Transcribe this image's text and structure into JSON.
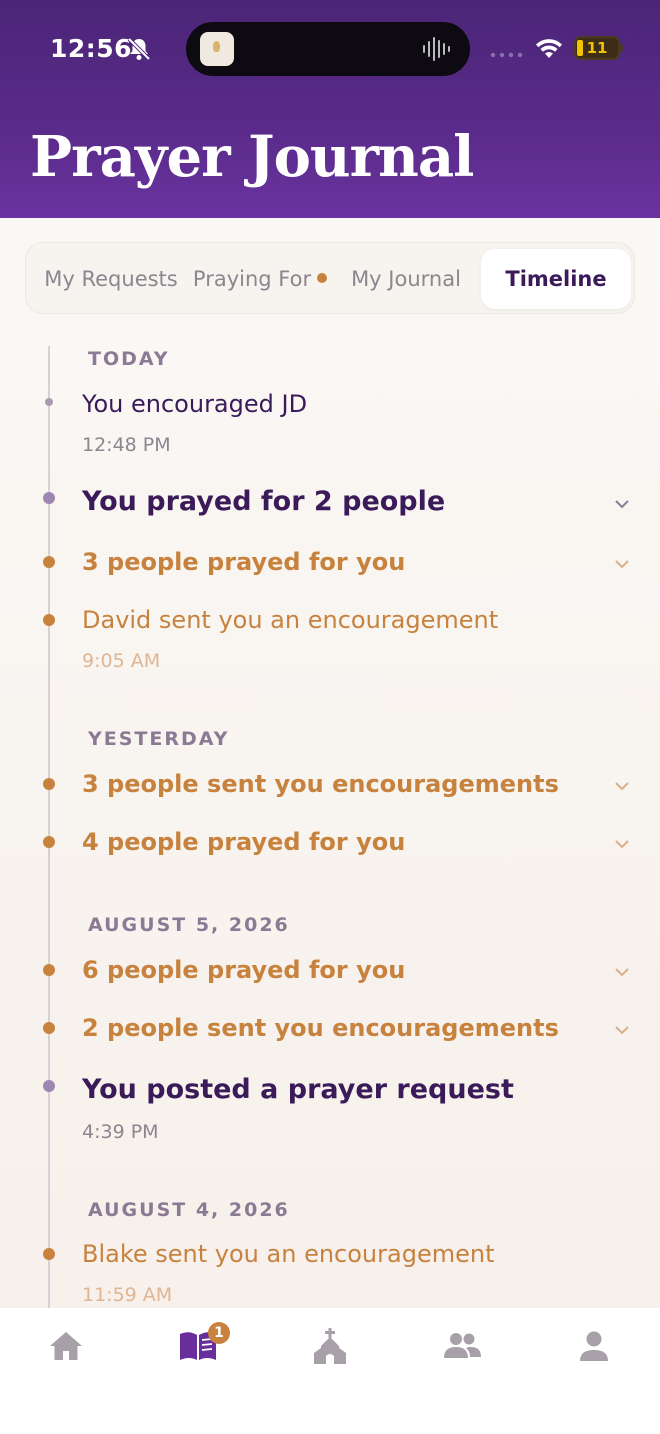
{
  "status_bar": {
    "time": "12:56",
    "battery": "11"
  },
  "header": {
    "title": "Prayer Journal"
  },
  "tabs": [
    {
      "label": "My Requests"
    },
    {
      "label": "Praying For"
    },
    {
      "label": "My Journal"
    },
    {
      "label": "Timeline"
    }
  ],
  "timeline": {
    "today": {
      "label": "TODAY",
      "e1": {
        "text": "You encouraged JD",
        "time": "12:48 PM"
      },
      "e2": {
        "text": "You prayed for 2 people"
      },
      "e3": {
        "text": "3 people prayed for you"
      },
      "e4": {
        "text": "David sent you an encouragement",
        "time": "9:05 AM"
      }
    },
    "yesterday": {
      "label": "YESTERDAY",
      "e1": {
        "text": "3 people sent you encouragements"
      },
      "e2": {
        "text": "4 people prayed for you"
      }
    },
    "aug5": {
      "label": "AUGUST 5, 2026",
      "e1": {
        "text": "6 people prayed for you"
      },
      "e2": {
        "text": "2 people sent you encouragements"
      },
      "e3": {
        "text": "You posted a prayer request",
        "time": "4:39 PM"
      }
    },
    "aug4": {
      "label": "AUGUST 4, 2026",
      "e1": {
        "text": "Blake sent you an encouragement",
        "time": "11:59 AM"
      }
    }
  },
  "nav": {
    "journal_badge": "1",
    "items": [
      "home-icon",
      "journal-icon",
      "church-icon",
      "people-icon",
      "profile-icon"
    ]
  },
  "colors": {
    "header_purple": "#5a2b8a",
    "accent_orange": "#c7823e",
    "text_purple": "#3b1a5a"
  }
}
